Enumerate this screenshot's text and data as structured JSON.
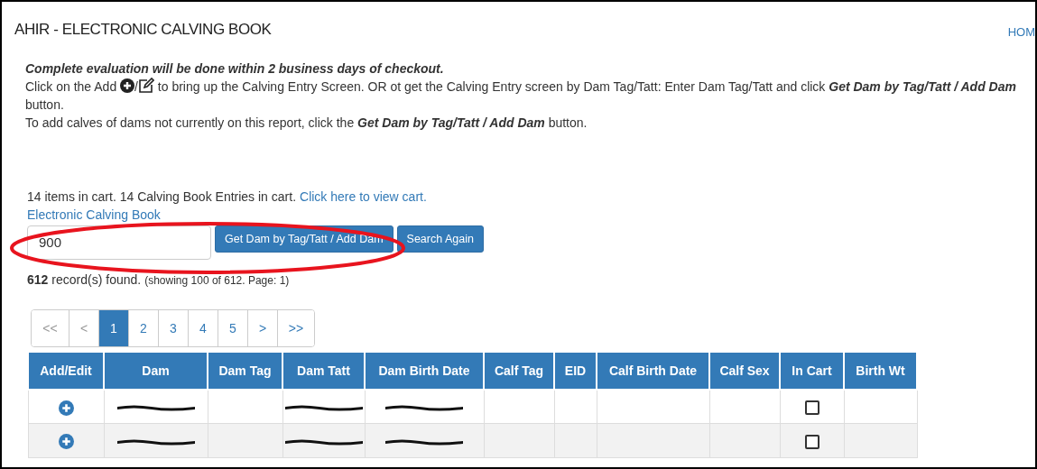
{
  "header": {
    "title": "AHIR - ELECTRONIC CALVING BOOK",
    "home_link": "HOM"
  },
  "notice": "Complete evaluation will be done within 2 business days of checkout.",
  "instructions": [
    {
      "before": "Click on the Add",
      "between": "/",
      "after": "to bring up the Calving Entry Screen. OR ot get the Calving Entry screen by Dam Tag/Tatt: Enter Dam Tag/Tatt and click **Get Dam by Tag/Tatt / Add Dam** button."
    },
    {
      "text": "To add calves of dams not currently on this report, click the **Get Dam by Tag/Tatt / Add Dam** button."
    }
  ],
  "cart": {
    "text": "14 items in cart. 14 Calving Book Entries in cart.",
    "link": "Click here to view cart."
  },
  "breadcrumb": "Electronic Calving Book",
  "search": {
    "value": "900",
    "buttons": [
      "Get Dam by Tag/Tatt / Add Dam",
      "Search Again"
    ]
  },
  "annotation": {
    "kind": "ellipse",
    "color": "#e8141e"
  },
  "results": {
    "count": "612",
    "text": "record(s) found.",
    "detail": "(showing 100 of 612. Page: 1)"
  },
  "pagination": [
    {
      "label": "<<",
      "selected": false,
      "disabled": true
    },
    {
      "label": "<",
      "selected": false,
      "disabled": true
    },
    {
      "label": "1",
      "selected": true,
      "disabled": false
    },
    {
      "label": "2",
      "selected": false,
      "disabled": false
    },
    {
      "label": "3",
      "selected": false,
      "disabled": false
    },
    {
      "label": "4",
      "selected": false,
      "disabled": false
    },
    {
      "label": "5",
      "selected": false,
      "disabled": false
    },
    {
      "label": ">",
      "selected": false,
      "disabled": false
    },
    {
      "label": ">>",
      "selected": false,
      "disabled": false
    }
  ],
  "table": {
    "columns": [
      "Add/Edit",
      "Dam",
      "Dam Tag",
      "Dam Tatt",
      "Dam Birth Date",
      "Calf Tag",
      "EID",
      "Calf Birth Date",
      "Calf Sex",
      "In Cart",
      "Birth Wt"
    ],
    "rows": [
      {
        "cells": [
          {
            "kind": "add"
          },
          {
            "kind": "redacted"
          },
          {
            "kind": "empty"
          },
          {
            "kind": "redacted"
          },
          {
            "kind": "redacted"
          },
          {
            "kind": "empty"
          },
          {
            "kind": "empty"
          },
          {
            "kind": "empty"
          },
          {
            "kind": "empty"
          },
          {
            "kind": "checkbox",
            "checked": false
          },
          {
            "kind": "empty"
          }
        ]
      },
      {
        "cells": [
          {
            "kind": "add"
          },
          {
            "kind": "redacted"
          },
          {
            "kind": "empty"
          },
          {
            "kind": "redacted"
          },
          {
            "kind": "redacted"
          },
          {
            "kind": "empty"
          },
          {
            "kind": "empty"
          },
          {
            "kind": "empty"
          },
          {
            "kind": "empty"
          },
          {
            "kind": "checkbox",
            "checked": false
          },
          {
            "kind": "empty"
          }
        ]
      }
    ]
  }
}
